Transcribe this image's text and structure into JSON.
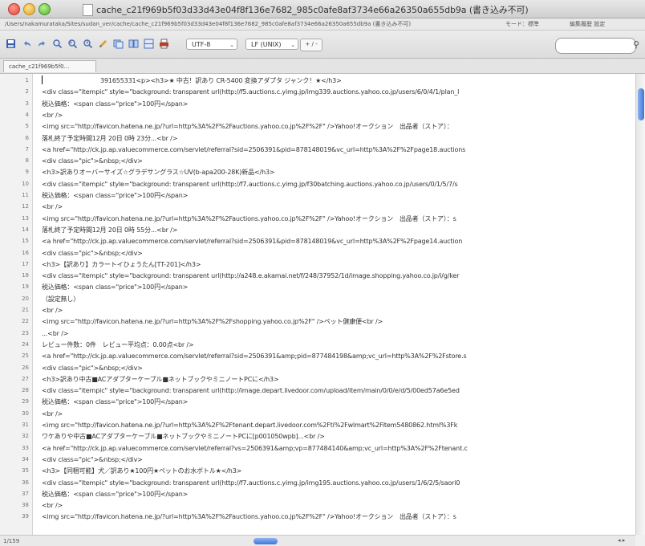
{
  "window": {
    "title": "cache_c21f969b5f03d33d43e04f8f136e7682_985c0afe8af3734e66a26350a655db9a (書き込み不可)"
  },
  "pathbar": {
    "path": "/Users/nakamurataka/Sites/sudan_ver/cache/cache_c21f969b5f03d33d43e04f8f136e7682_985c0afe8af3734e66a26350a655db9a (書き込み不可)",
    "info": "モード：標準",
    "extra": "編集履歴 設定"
  },
  "toolbar": {
    "encoding": "UTF-8",
    "line_ending": "LF (UNIX)",
    "mini_controls": "+ / -",
    "search_placeholder": ""
  },
  "tabs": [
    {
      "label": "cache_c21f969b5f0..."
    }
  ],
  "editor": {
    "lines": [
      {
        "n": "1",
        "code": "391655331<p><h3>★ 中古！訳あり CR-5400 変換アダプタ ジャンク！★</h3>"
      },
      {
        "n": "2",
        "code": "<div class=\"itempic\" style=\"background: transparent url(http://f5.auctions.c.yimg.jp/img339.auctions.yahoo.co.jp/users/6/0/4/1/plan_l"
      },
      {
        "n": "3",
        "code": "税込価格：<span class=\"price\">100円</span>"
      },
      {
        "n": "4",
        "code": "<br />"
      },
      {
        "n": "5",
        "code": "<img src=\"http://favicon.hatena.ne.jp/?url=http%3A%2F%2Fauctions.yahoo.co.jp%2F%2F\" />Yahoo!オークション　出品者（ストア）："
      },
      {
        "n": "6",
        "code": "落札終了予定時間12月 20日 0時 23分...<br />"
      },
      {
        "n": "7",
        "code": "<a href=\"http://ck.jp.ap.valuecommerce.com/servlet/referral?sid=2506391&pid=878148019&vc_url=http%3A%2F%2Fpage18.auctions"
      },
      {
        "n": "8",
        "code": "<div class=\"pic\">&nbsp;</div>"
      },
      {
        "n": "9",
        "code": "<h3>訳ありオーバーサイズ☆グラデサングラス☆UV(b-apa200-28K)新品</h3>"
      },
      {
        "n": "10",
        "code": "<div class=\"itempic\" style=\"background: transparent url(http://f7.auctions.c.yimg.jp/f30batching.auctions.yahoo.co.jp/users/0/1/5/7/s"
      },
      {
        "n": "11",
        "code": "税込価格：<span class=\"price\">100円</span>"
      },
      {
        "n": "12",
        "code": "<br />"
      },
      {
        "n": "13",
        "code": "<img src=\"http://favicon.hatena.ne.jp/?url=http%3A%2F%2Fauctions.yahoo.co.jp%2F%2F\" />Yahoo!オークション　出品者（ストア）：s"
      },
      {
        "n": "14",
        "code": "落札終了予定時間12月 20日 0時 55分...<br />"
      },
      {
        "n": "15",
        "code": "<a href=\"http://ck.jp.ap.valuecommerce.com/servlet/referral?sid=2506391&pid=878148019&vc_url=http%3A%2F%2Fpage14.auction"
      },
      {
        "n": "16",
        "code": "<div class=\"pic\">&nbsp;</div>"
      },
      {
        "n": "17",
        "code": "<h3>【訳あり】カラートイひょうたん[TT-201]</h3>"
      },
      {
        "n": "18",
        "code": "<div class=\"itempic\" style=\"background: transparent url(http://a248.e.akamai.net/f/248/37952/1d/image.shopping.yahoo.co.jp/i/g/ker"
      },
      {
        "n": "19",
        "code": "税込価格：<span class=\"price\">100円</span>"
      },
      {
        "n": "20",
        "code": "（設定無し）"
      },
      {
        "n": "21",
        "code": "<br />"
      },
      {
        "n": "22",
        "code": "<img src=\"http://favicon.hatena.ne.jp/?url=http%3A%2F%2Fshopping.yahoo.co.jp%2F\" />ペット健康便<br />"
      },
      {
        "n": "23",
        "code": "...<br />"
      },
      {
        "n": "24",
        "code": "レビュー件数：0件　レビュー平均点：0.00点<br />"
      },
      {
        "n": "25",
        "code": "<a href=\"http://ck.jp.ap.valuecommerce.com/servlet/referral?sid=2506391&amp;pid=877484198&amp;vc_url=http%3A%2F%2Fstore.s"
      },
      {
        "n": "26",
        "code": "<div class=\"pic\">&nbsp;</div>"
      },
      {
        "n": "27",
        "code": "<h3>訳あり中古■ACアダプターケーブル■ネットブックやミニノートPCに</h3>"
      },
      {
        "n": "28",
        "code": "<div class=\"itempic\" style=\"background: transparent url(http://image.depart.livedoor.com/upload/item/main/0/0/e/d/5/00ed57a6e5ed"
      },
      {
        "n": "29",
        "code": "税込価格：<span class=\"price\">100円</span>"
      },
      {
        "n": "30",
        "code": "<br />"
      },
      {
        "n": "31",
        "code": "<img src=\"http://favicon.hatena.ne.jp/?url=http%3A%2F%2Ftenant.depart.livedoor.com%2Fti%2Fwlmart%2Fitem5480862.html%3Fk"
      },
      {
        "n": "32",
        "code": "ワケありや中古■ACアダプターケーブル■ネットブックやミニノートPCに[p001050wpb]...<br />"
      },
      {
        "n": "33",
        "code": "<a href=\"http://ck.jp.ap.valuecommerce.com/servlet/referral?vs=2506391&amp;vp=877484140&amp;vc_url=http%3A%2F%2Ftenant.c"
      },
      {
        "n": "34",
        "code": "<div class=\"pic\">&nbsp;</div>"
      },
      {
        "n": "35",
        "code": "<h3>【同梱可能】犬／訳あり★100円★ペットのお水ボトル★</h3>"
      },
      {
        "n": "36",
        "code": "<div class=\"itempic\" style=\"background: transparent url(http://f7.auctions.c.yimg.jp/img195.auctions.yahoo.co.jp/users/1/6/2/5/saori0"
      },
      {
        "n": "37",
        "code": "税込価格：<span class=\"price\">100円</span>"
      },
      {
        "n": "38",
        "code": "<br />"
      },
      {
        "n": "39",
        "code": "<img src=\"http://favicon.hatena.ne.jp/?url=http%3A%2F%2Fauctions.yahoo.co.jp%2F%2F\" />Yahoo!オークション　出品者（ストア）：s"
      }
    ]
  },
  "statusbar": {
    "position": "1/159",
    "arrows": "◂ ▸"
  }
}
